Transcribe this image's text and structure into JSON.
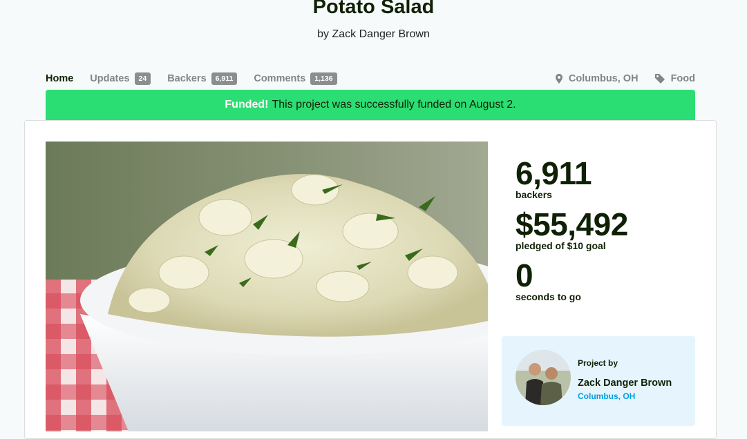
{
  "project": {
    "title": "Potato Salad",
    "byline": "by Zack Danger Brown"
  },
  "tabs": [
    {
      "label": "Home",
      "count": null,
      "active": true
    },
    {
      "label": "Updates",
      "count": "24"
    },
    {
      "label": "Backers",
      "count": "6,911"
    },
    {
      "label": "Comments",
      "count": "1,136"
    }
  ],
  "meta": {
    "location": "Columbus, OH",
    "location_icon": "map-pin-icon",
    "category": "Food",
    "category_icon": "tag-icon"
  },
  "banner": {
    "strong": "Funded!",
    "text": "This project was successfully funded on August 2.",
    "color": "#2bde73"
  },
  "stats": [
    {
      "value": "6,911",
      "label": "backers"
    },
    {
      "value": "$55,492",
      "label": "pledged of $10 goal"
    },
    {
      "value": "0",
      "label": "seconds to go"
    }
  ],
  "creator": {
    "heading": "Project by",
    "name": "Zack Danger Brown",
    "location": "Columbus, OH"
  },
  "colors": {
    "accent_green": "#2bde73",
    "text_dark": "#0f2105",
    "link_blue": "#009ee2",
    "creator_bg": "#e6f5fd"
  }
}
